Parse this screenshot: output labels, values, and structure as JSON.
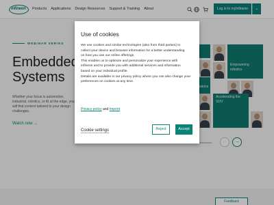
{
  "header": {
    "logo_text": "infineon",
    "nav": [
      "Products",
      "Applications",
      "Design Resources",
      "Support & Training",
      "About"
    ],
    "search_icon": "search-icon",
    "globe_icon": "globe-icon",
    "cart_icon": "cart-icon",
    "login_label": "Log in to myInfineon"
  },
  "hero": {
    "series_label": "WEBINAR SERIES",
    "title_line1": "Embedded",
    "title_line2": "Systems",
    "description": "Whether your focus is automotive, industrial, robotics, or AI at the edge, you will find content tailored to your design challenges.",
    "watch_label": "Watch now →"
  },
  "tiles": {
    "top_right": "Empowering robotics",
    "middle": "ations",
    "bottom_right": "Accelerating the SDV"
  },
  "slider": {
    "next_icon": "arrow-right-icon",
    "prev_icon": "arrow-left-icon"
  },
  "feedback_label": "Feedback",
  "cookie_modal": {
    "title": "Use of cookies",
    "body_lines": [
      "We use cookies and similar technologies (also from third parties) to",
      "collect your device and browser information for a better understanding",
      "on how you use our online offerings.",
      "This enables us to optimize and personalize your experience with",
      "Infineon and to provide you with additional services and information",
      "based on your individual profile.",
      "Details are available in our privacy policy where you can also change your",
      "preferences on cookies at any time."
    ],
    "privacy_link": "Privacy policy",
    "and_text": "and",
    "imprint_link": "Imprint",
    "settings_label": "Cookie settings",
    "reject_label": "Reject",
    "accept_label": "Accept"
  },
  "colors": {
    "brand": "#0a8276"
  }
}
